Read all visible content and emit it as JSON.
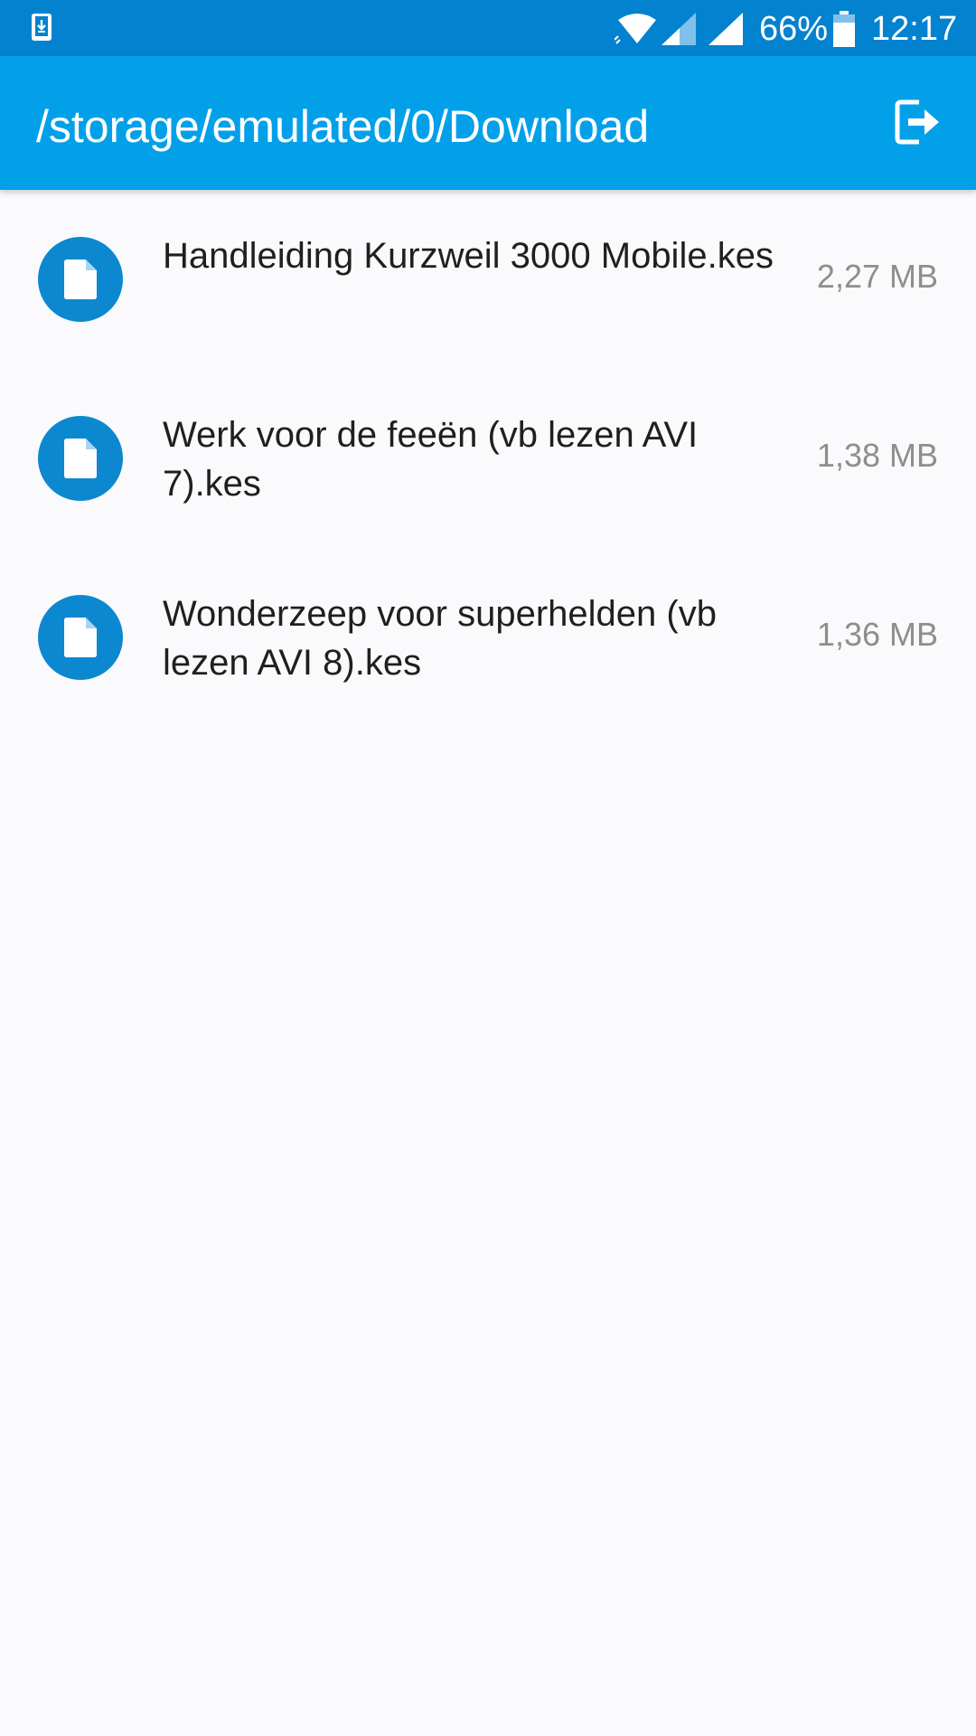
{
  "status_bar": {
    "battery_percent": "66%",
    "time": "12:17",
    "icons": [
      "download-notification-icon",
      "wifi-icon",
      "signal-icon",
      "signal-icon",
      "battery-icon"
    ]
  },
  "app_bar": {
    "title": "/storage/emulated/0/Download",
    "action_icon": "exit-icon"
  },
  "files": [
    {
      "name": "Handleiding Kurzweil 3000 Mobile.kes",
      "size": "2,27 MB",
      "icon": "file-icon"
    },
    {
      "name": "Werk voor de feeën (vb lezen AVI 7).kes",
      "size": "1,38 MB",
      "icon": "file-icon"
    },
    {
      "name": "Wonderzeep voor superhelden (vb lezen AVI 8).kes",
      "size": "1,36 MB",
      "icon": "file-icon"
    }
  ],
  "colors": {
    "status_bar": "#0282cf",
    "app_bar": "#03a0ea",
    "file_icon_bg": "#0b88d0",
    "background": "#fafafc",
    "name_text": "#1f1f1f",
    "size_text": "#8e8e8e"
  }
}
